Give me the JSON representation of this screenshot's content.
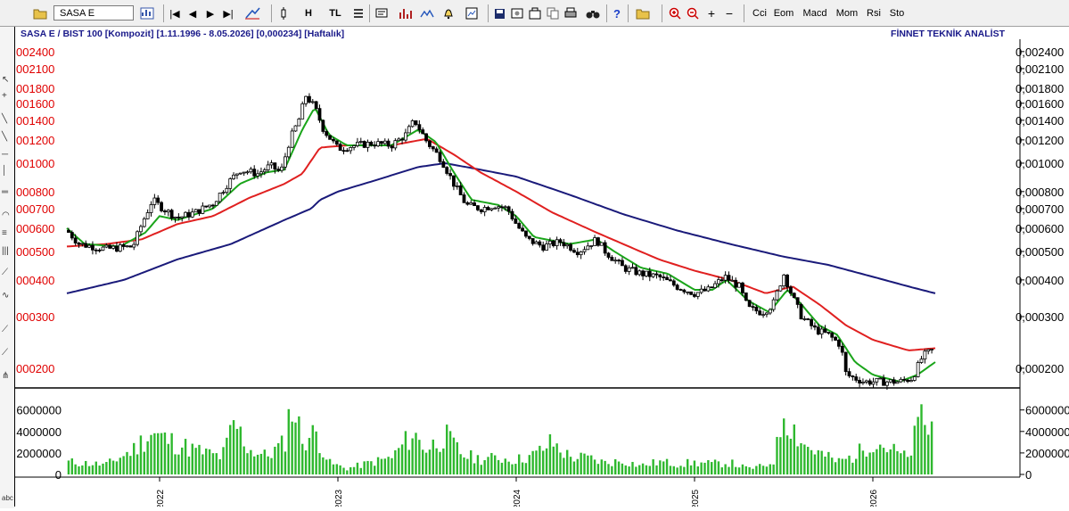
{
  "toolbar": {
    "symbol": "SASA  E",
    "buttons": [
      "|◀",
      "◀",
      "▶",
      "▶|",
      "H",
      "TL"
    ],
    "indicators": [
      "Cci",
      "Eom",
      "Macd",
      "Mom",
      "Rsi",
      "Sto"
    ]
  },
  "header": {
    "title": "SASA  E / BIST 100 [Kompozit]  [1.11.1996 - 8.05.2026]  [0,000234]  [Haftalık]",
    "brand": "FİNNET TEKNİK ANALİST"
  },
  "colors": {
    "ma_fast": "#1aa51a",
    "ma_mid": "#e02020",
    "ma_slow": "#1a1a7a",
    "volume": "#2eb82e",
    "left_labels": "#e00000"
  },
  "chart_data": [
    {
      "type": "candlestick",
      "scale": "log",
      "y_ticks": [
        0.0002,
        0.0003,
        0.0004,
        0.0005,
        0.0006,
        0.0007,
        0.0008,
        0.001,
        0.0012,
        0.0014,
        0.0016,
        0.0018,
        0.0021,
        0.0024
      ],
      "y_tick_labels_left": [
        "000200",
        "000300",
        "000400",
        "000500",
        "000600",
        "000700",
        "000800",
        "001000",
        "001200",
        "001400",
        "001600",
        "001800",
        "002100",
        "002400"
      ],
      "y_tick_labels_right": [
        "0,000200",
        "0,000300",
        "0,000400",
        "0,000500",
        "0,000600",
        "0,000700",
        "0,000800",
        "0,001000",
        "0,001200",
        "0,001400",
        "0,001600",
        "0,001800",
        "0,002100",
        "0,002400"
      ],
      "ylim": [
        0.00018,
        0.0025
      ],
      "x_year_labels": [
        "2022",
        "2023",
        "2024",
        "2025",
        "2026"
      ],
      "x_year_starts": [
        2022.0,
        2023.0,
        2024.0,
        2025.0,
        2026.0
      ],
      "xlim": [
        2021.48,
        2026.42
      ],
      "close_keypoints": [
        [
          2021.48,
          0.00059
        ],
        [
          2021.55,
          0.00053
        ],
        [
          2021.7,
          0.00051
        ],
        [
          2021.85,
          0.00052
        ],
        [
          2021.9,
          0.00062
        ],
        [
          2021.96,
          0.00075
        ],
        [
          2022.02,
          0.0007
        ],
        [
          2022.1,
          0.00065
        ],
        [
          2022.2,
          0.00068
        ],
        [
          2022.3,
          0.00073
        ],
        [
          2022.38,
          0.00085
        ],
        [
          2022.45,
          0.00095
        ],
        [
          2022.55,
          0.00092
        ],
        [
          2022.62,
          0.00098
        ],
        [
          2022.68,
          0.00093
        ],
        [
          2022.73,
          0.0012
        ],
        [
          2022.78,
          0.0014
        ],
        [
          2022.82,
          0.0017
        ],
        [
          2022.87,
          0.00155
        ],
        [
          2022.92,
          0.0013
        ],
        [
          2023.0,
          0.00112
        ],
        [
          2023.1,
          0.00115
        ],
        [
          2023.2,
          0.00117
        ],
        [
          2023.3,
          0.00115
        ],
        [
          2023.38,
          0.00125
        ],
        [
          2023.43,
          0.0014
        ],
        [
          2023.5,
          0.00118
        ],
        [
          2023.58,
          0.00103
        ],
        [
          2023.65,
          0.00085
        ],
        [
          2023.72,
          0.00072
        ],
        [
          2023.8,
          0.0007
        ],
        [
          2023.88,
          0.00072
        ],
        [
          2023.95,
          0.0007
        ],
        [
          2024.0,
          0.00062
        ],
        [
          2024.06,
          0.00055
        ],
        [
          2024.15,
          0.00052
        ],
        [
          2024.25,
          0.00054
        ],
        [
          2024.35,
          0.0005
        ],
        [
          2024.45,
          0.00055
        ],
        [
          2024.5,
          0.0005
        ],
        [
          2024.6,
          0.00044
        ],
        [
          2024.7,
          0.00042
        ],
        [
          2024.8,
          0.00041
        ],
        [
          2024.9,
          0.00038
        ],
        [
          2025.0,
          0.00036
        ],
        [
          2025.08,
          0.00037
        ],
        [
          2025.17,
          0.00041
        ],
        [
          2025.25,
          0.00038
        ],
        [
          2025.3,
          0.00032
        ],
        [
          2025.38,
          0.00031
        ],
        [
          2025.44,
          0.00033
        ],
        [
          2025.5,
          0.00042
        ],
        [
          2025.55,
          0.00035
        ],
        [
          2025.6,
          0.0003
        ],
        [
          2025.68,
          0.00027
        ],
        [
          2025.75,
          0.00026
        ],
        [
          2025.82,
          0.00024
        ],
        [
          2025.85,
          0.00019
        ],
        [
          2025.95,
          0.00018
        ],
        [
          2026.05,
          0.00018
        ],
        [
          2026.15,
          0.00018
        ],
        [
          2026.22,
          0.000185
        ],
        [
          2026.28,
          0.00022
        ],
        [
          2026.35,
          0.000234
        ]
      ],
      "ma_fast_keypoints": [
        [
          2021.48,
          0.0006
        ],
        [
          2021.58,
          0.00053
        ],
        [
          2021.78,
          0.00052
        ],
        [
          2021.92,
          0.00058
        ],
        [
          2022.0,
          0.00066
        ],
        [
          2022.1,
          0.00064
        ],
        [
          2022.3,
          0.0007
        ],
        [
          2022.45,
          0.00085
        ],
        [
          2022.6,
          0.00093
        ],
        [
          2022.7,
          0.00095
        ],
        [
          2022.8,
          0.0013
        ],
        [
          2022.87,
          0.00155
        ],
        [
          2022.95,
          0.00125
        ],
        [
          2023.05,
          0.00115
        ],
        [
          2023.3,
          0.00115
        ],
        [
          2023.45,
          0.0013
        ],
        [
          2023.55,
          0.00118
        ],
        [
          2023.65,
          0.00093
        ],
        [
          2023.75,
          0.00075
        ],
        [
          2023.9,
          0.00072
        ],
        [
          2024.0,
          0.00066
        ],
        [
          2024.1,
          0.00056
        ],
        [
          2024.3,
          0.00053
        ],
        [
          2024.45,
          0.00055
        ],
        [
          2024.55,
          0.0005
        ],
        [
          2024.7,
          0.00044
        ],
        [
          2024.85,
          0.00042
        ],
        [
          2025.0,
          0.00037
        ],
        [
          2025.1,
          0.00037
        ],
        [
          2025.18,
          0.0004
        ],
        [
          2025.3,
          0.00034
        ],
        [
          2025.42,
          0.00031
        ],
        [
          2025.52,
          0.00037
        ],
        [
          2025.6,
          0.00033
        ],
        [
          2025.7,
          0.00028
        ],
        [
          2025.8,
          0.00026
        ],
        [
          2025.9,
          0.00021
        ],
        [
          2026.0,
          0.00019
        ],
        [
          2026.15,
          0.00018
        ],
        [
          2026.25,
          0.00019
        ],
        [
          2026.35,
          0.00021
        ]
      ],
      "ma_mid_keypoints": [
        [
          2021.48,
          0.00052
        ],
        [
          2021.7,
          0.00053
        ],
        [
          2021.9,
          0.00055
        ],
        [
          2022.1,
          0.00062
        ],
        [
          2022.3,
          0.00066
        ],
        [
          2022.5,
          0.00076
        ],
        [
          2022.7,
          0.00085
        ],
        [
          2022.8,
          0.00092
        ],
        [
          2022.9,
          0.00113
        ],
        [
          2023.05,
          0.00115
        ],
        [
          2023.3,
          0.00115
        ],
        [
          2023.5,
          0.00121
        ],
        [
          2023.65,
          0.00107
        ],
        [
          2023.8,
          0.00093
        ],
        [
          2024.0,
          0.0008
        ],
        [
          2024.2,
          0.00068
        ],
        [
          2024.45,
          0.00058
        ],
        [
          2024.6,
          0.00053
        ],
        [
          2024.8,
          0.00047
        ],
        [
          2025.0,
          0.00043
        ],
        [
          2025.2,
          0.0004
        ],
        [
          2025.4,
          0.00036
        ],
        [
          2025.55,
          0.00038
        ],
        [
          2025.7,
          0.00033
        ],
        [
          2025.85,
          0.00028
        ],
        [
          2026.0,
          0.00025
        ],
        [
          2026.2,
          0.00023
        ],
        [
          2026.35,
          0.000234
        ]
      ],
      "ma_slow_keypoints": [
        [
          2021.48,
          0.00036
        ],
        [
          2021.8,
          0.0004
        ],
        [
          2022.1,
          0.00047
        ],
        [
          2022.4,
          0.00053
        ],
        [
          2022.7,
          0.00064
        ],
        [
          2022.85,
          0.0007
        ],
        [
          2022.9,
          0.00075
        ],
        [
          2023.0,
          0.0008
        ],
        [
          2023.2,
          0.00087
        ],
        [
          2023.45,
          0.00097
        ],
        [
          2023.6,
          0.001
        ],
        [
          2023.8,
          0.00095
        ],
        [
          2024.0,
          0.0009
        ],
        [
          2024.3,
          0.00078
        ],
        [
          2024.6,
          0.00067
        ],
        [
          2024.9,
          0.00059
        ],
        [
          2025.2,
          0.00053
        ],
        [
          2025.5,
          0.00048
        ],
        [
          2025.75,
          0.00045
        ],
        [
          2026.0,
          0.00041
        ],
        [
          2026.2,
          0.00038
        ],
        [
          2026.35,
          0.00036
        ]
      ],
      "series": [
        {
          "color": "#1aa51a"
        },
        {
          "color": "#e02020"
        },
        {
          "color": "#1a1a7a"
        }
      ]
    },
    {
      "type": "bar",
      "y_ticks": [
        0,
        2000000,
        4000000,
        6000000
      ],
      "y_tick_labels": [
        "0",
        "2000000",
        "4000000",
        "6000000"
      ],
      "ylim": [
        0,
        7800000
      ],
      "volume_keypoints": [
        [
          2021.48,
          1300000
        ],
        [
          2021.7,
          1000000
        ],
        [
          2021.85,
          2500000
        ],
        [
          2021.95,
          4300000
        ],
        [
          2022.05,
          3500000
        ],
        [
          2022.2,
          2500000
        ],
        [
          2022.35,
          1800000
        ],
        [
          2022.42,
          5300000
        ],
        [
          2022.5,
          2600000
        ],
        [
          2022.6,
          1900000
        ],
        [
          2022.7,
          3200000
        ],
        [
          2022.74,
          7500000
        ],
        [
          2022.8,
          3600000
        ],
        [
          2022.88,
          4200000
        ],
        [
          2022.95,
          1200000
        ],
        [
          2023.05,
          600000
        ],
        [
          2023.2,
          1300000
        ],
        [
          2023.3,
          1700000
        ],
        [
          2023.42,
          4200000
        ],
        [
          2023.5,
          2600000
        ],
        [
          2023.6,
          4000000
        ],
        [
          2023.7,
          2000000
        ],
        [
          2023.8,
          1600000
        ],
        [
          2023.9,
          1700000
        ],
        [
          2024.0,
          1500000
        ],
        [
          2024.1,
          2000000
        ],
        [
          2024.2,
          3300000
        ],
        [
          2024.3,
          1800000
        ],
        [
          2024.4,
          1700000
        ],
        [
          2024.5,
          1200000
        ],
        [
          2024.6,
          1400000
        ],
        [
          2024.7,
          900000
        ],
        [
          2024.8,
          1300000
        ],
        [
          2024.9,
          1100000
        ],
        [
          2025.0,
          1200000
        ],
        [
          2025.1,
          1100000
        ],
        [
          2025.2,
          1200000
        ],
        [
          2025.3,
          600000
        ],
        [
          2025.4,
          900000
        ],
        [
          2025.45,
          1600000
        ],
        [
          2025.5,
          6800000
        ],
        [
          2025.56,
          4600000
        ],
        [
          2025.62,
          3000000
        ],
        [
          2025.7,
          2200000
        ],
        [
          2025.8,
          1300000
        ],
        [
          2025.9,
          1900000
        ],
        [
          2026.0,
          3600000
        ],
        [
          2026.1,
          2600000
        ],
        [
          2026.2,
          1600000
        ],
        [
          2026.28,
          6600000
        ],
        [
          2026.32,
          3700000
        ],
        [
          2026.35,
          7800000
        ]
      ]
    }
  ]
}
